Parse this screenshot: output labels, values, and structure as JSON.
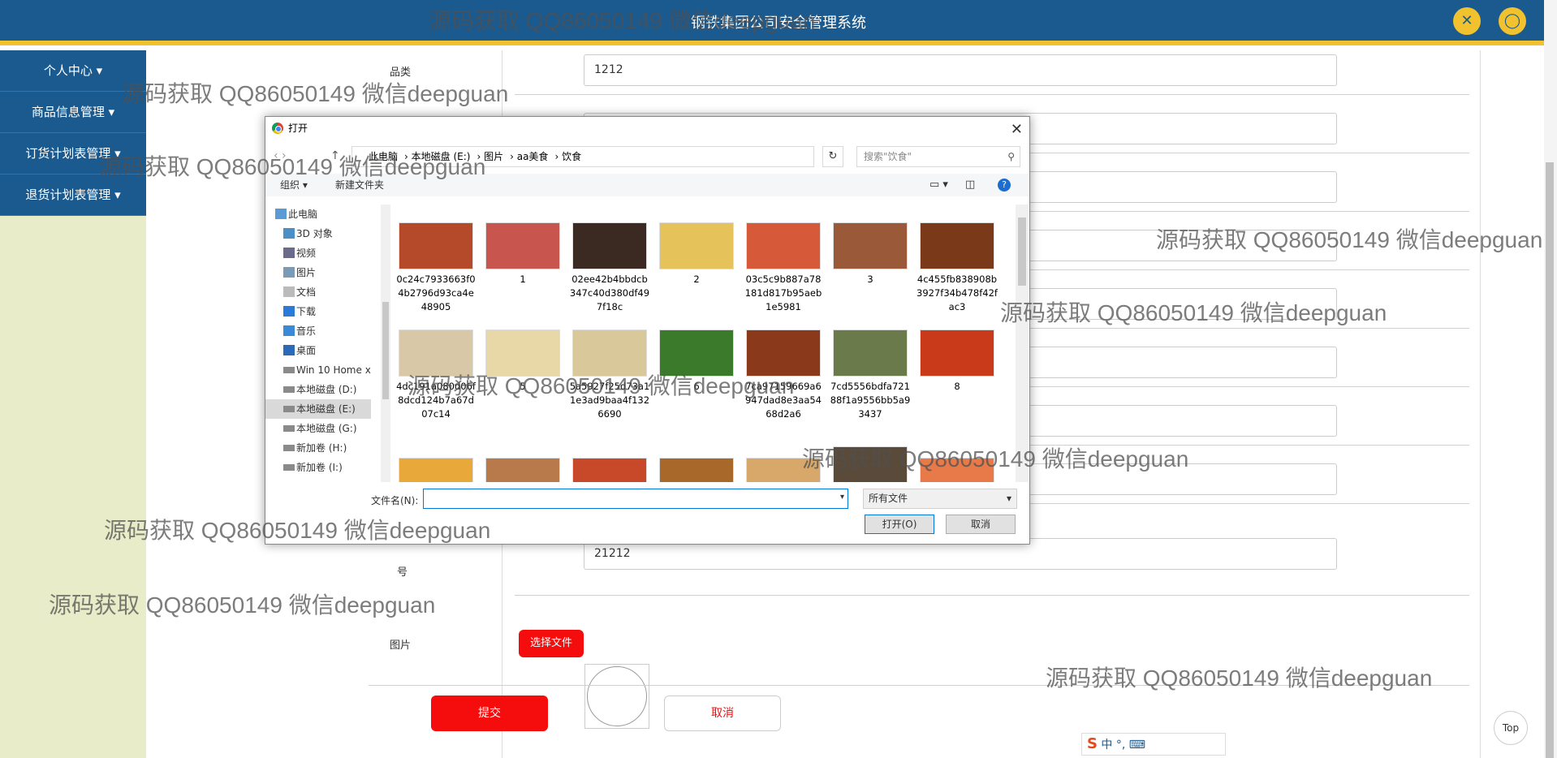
{
  "header": {
    "title": "钢铁集团公司安全管理系统"
  },
  "sidebar": {
    "items": [
      {
        "label": "个人中心"
      },
      {
        "label": "商品信息管理"
      },
      {
        "label": "订货计划表管理"
      },
      {
        "label": "退货计划表管理"
      }
    ]
  },
  "form": {
    "category_label": "品类",
    "category_value": "1212",
    "hao_label": "号",
    "number_value": "21212",
    "image_label": "图片",
    "choose_file": "选择文件",
    "submit": "提交",
    "cancel": "取消"
  },
  "dialog": {
    "title": "打开",
    "breadcrumb": [
      "此电脑",
      "本地磁盘 (E:)",
      "图片",
      "aa美食",
      "饮食"
    ],
    "search_placeholder": "搜索\"饮食\"",
    "organize": "组织",
    "new_folder": "新建文件夹",
    "tree": [
      "此电脑",
      "3D 对象",
      "视频",
      "图片",
      "文档",
      "下载",
      "音乐",
      "桌面",
      "Win 10 Home x",
      "本地磁盘 (D:)",
      "本地磁盘 (E:)",
      "本地磁盘 (G:)",
      "新加卷 (H:)",
      "新加卷 (I:)"
    ],
    "files_row1": [
      {
        "name": "0c24c7933663f04b2796d93ca4e48905",
        "color": "#b54a2a"
      },
      {
        "name": "1",
        "color": "#c8564f"
      },
      {
        "name": "02ee42b4bbdcb347c40d380df497f18c",
        "color": "#3a2a22"
      },
      {
        "name": "2",
        "color": "#e5c25a"
      },
      {
        "name": "03c5c9b887a78181d817b95aeb1e5981",
        "color": "#d65a3a"
      },
      {
        "name": "3",
        "color": "#9a5a3a"
      },
      {
        "name": "4c455fb838908b3927f34b478f42fac3",
        "color": "#7a3a1a"
      }
    ],
    "files_row2": [
      {
        "name": "4dc191a080d06f8dcd124b7a67d07c14",
        "color": "#d8c8a8"
      },
      {
        "name": "5",
        "color": "#e8d8a8"
      },
      {
        "name": "5a5927f25d73a11e3ad9baa4f1326690",
        "color": "#d8c89a"
      },
      {
        "name": "6",
        "color": "#3a7a2a"
      },
      {
        "name": "7ca97159669a6947dad8e3aa5468d2a6",
        "color": "#8a3a1a"
      },
      {
        "name": "7cd5556bdfa72188f1a9556bb5a93437",
        "color": "#6a7a4a"
      },
      {
        "name": "8",
        "color": "#c83a1a"
      }
    ],
    "filename_label": "文件名(N):",
    "filetype": "所有文件",
    "open_btn": "打开(O)",
    "cancel_btn": "取消"
  },
  "ime": {
    "text": "中 °, ⌨"
  },
  "top_link": "Top",
  "watermark": "源码获取 QQ86050149 微信deepguan"
}
